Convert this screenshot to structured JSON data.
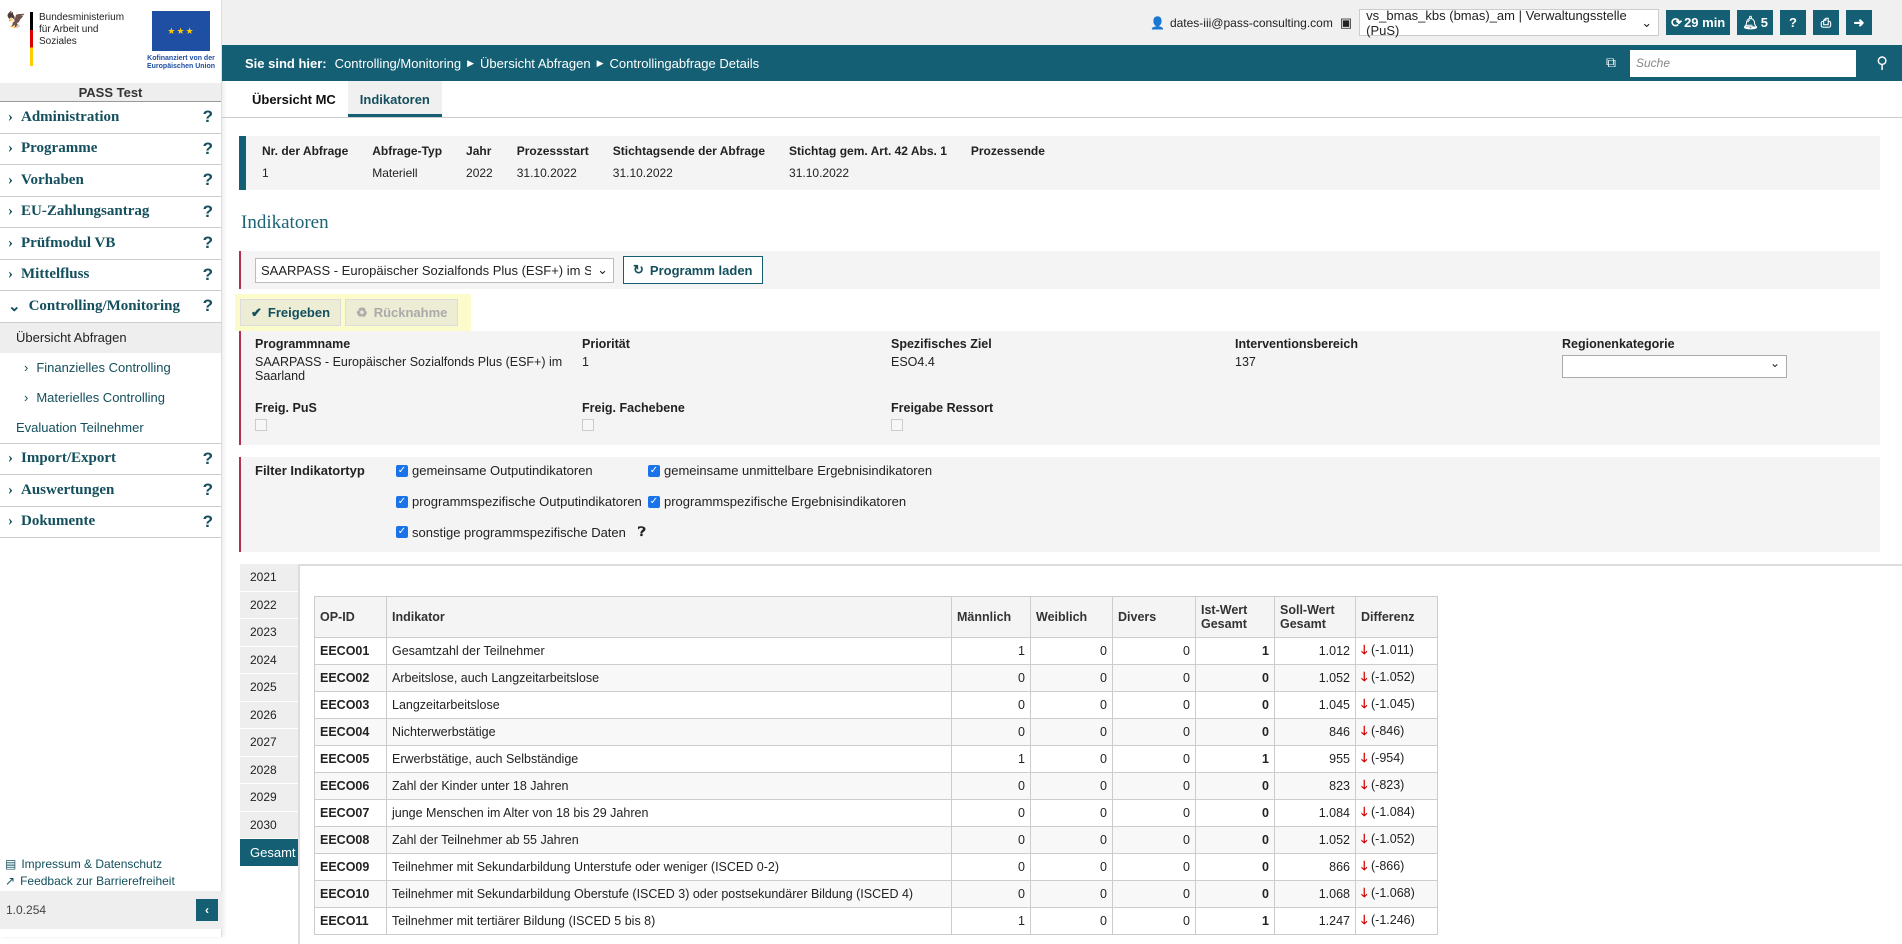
{
  "logos": {
    "ministry": "Bundesministerium für Arbeit und Soziales",
    "eu": "Kofinanziert von der Europäischen Union"
  },
  "sidebar": {
    "app_name": "PASS Test",
    "items": [
      {
        "label": "Administration"
      },
      {
        "label": "Programme"
      },
      {
        "label": "Vorhaben"
      },
      {
        "label": "EU-Zahlungsantrag"
      },
      {
        "label": "Prüfmodul VB"
      },
      {
        "label": "Mittelfluss"
      },
      {
        "label": "Controlling/Monitoring"
      }
    ],
    "subitems": [
      {
        "label": "Übersicht Abfragen"
      },
      {
        "label": "Finanzielles Controlling"
      },
      {
        "label": "Materielles Controlling"
      },
      {
        "label": "Evaluation Teilnehmer"
      }
    ],
    "items2": [
      {
        "label": "Import/Export"
      },
      {
        "label": "Auswertungen"
      },
      {
        "label": "Dokumente"
      }
    ],
    "help": "?",
    "footer": {
      "impressum": "Impressum & Datenschutz",
      "feedback": "Feedback zur Barrierefreiheit",
      "version": "1.0.254"
    }
  },
  "topbar": {
    "user": "dates-iii@pass-consulting.com",
    "role": "vs_bmas_kbs (bmas)_am | Verwaltungsstelle (PuS)",
    "session": "29 min",
    "notifications": "5",
    "help": "?"
  },
  "breadcrumb": {
    "prefix": "Sie sind hier:",
    "items": [
      "Controlling/Monitoring",
      "Übersicht Abfragen",
      "Controllingabfrage Details"
    ],
    "search_placeholder": "Suche"
  },
  "tabs": [
    {
      "label": "Übersicht MC"
    },
    {
      "label": "Indikatoren"
    }
  ],
  "info": {
    "headers": [
      "Nr. der Abfrage",
      "Abfrage-Typ",
      "Jahr",
      "Prozessstart",
      "Stichtagsende der Abfrage",
      "Stichtag gem. Art. 42 Abs. 1",
      "Prozessende"
    ],
    "values": [
      "1",
      "Materiell",
      "2022",
      "31.10.2022",
      "31.10.2022",
      "31.10.2022",
      ""
    ]
  },
  "section_title": "Indikatoren",
  "program": {
    "selected": "SAARPASS - Europäischer Sozialfonds Plus (ESF+) im Saarland",
    "load_button": "Programm laden"
  },
  "actions": {
    "release": "Freigeben",
    "withdraw": "Rücknahme"
  },
  "details": {
    "programmname_label": "Programmname",
    "programmname": "SAARPASS - Europäischer Sozialfonds Plus (ESF+) im Saarland",
    "prioritaet_label": "Priorität",
    "prioritaet": "1",
    "ziel_label": "Spezifisches Ziel",
    "ziel": "ESO4.4",
    "bereich_label": "Interventionsbereich",
    "bereich": "137",
    "region_label": "Regionenkategorie",
    "freig_pus": "Freig. PuS",
    "freig_fach": "Freig. Fachebene",
    "freig_ressort": "Freigabe Ressort"
  },
  "filter": {
    "label": "Filter Indikatortyp",
    "options": [
      "gemeinsame Outputindikatoren",
      "gemeinsame unmittelbare Ergebnisindikatoren",
      "programmspezifische Outputindikatoren",
      "programmspezifische Ergebnisindikatoren",
      "sonstige programmspezifische Daten"
    ]
  },
  "years": [
    "2021",
    "2022",
    "2023",
    "2024",
    "2025",
    "2026",
    "2027",
    "2028",
    "2029",
    "2030",
    "Gesamt"
  ],
  "active_year": "Gesamt",
  "table": {
    "headers": [
      "OP-ID",
      "Indikator",
      "Männlich",
      "Weiblich",
      "Divers",
      "Ist-Wert Gesamt",
      "Soll-Wert Gesamt",
      "Differenz"
    ],
    "rows": [
      [
        "EECO01",
        "Gesamtzahl der Teilnehmer",
        "1",
        "0",
        "0",
        "1",
        "1.012",
        "(-1.011)"
      ],
      [
        "EECO02",
        "Arbeitslose, auch Langzeitarbeitslose",
        "0",
        "0",
        "0",
        "0",
        "1.052",
        "(-1.052)"
      ],
      [
        "EECO03",
        "Langzeitarbeitslose",
        "0",
        "0",
        "0",
        "0",
        "1.045",
        "(-1.045)"
      ],
      [
        "EECO04",
        "Nichterwerbstätige",
        "0",
        "0",
        "0",
        "0",
        "846",
        "(-846)"
      ],
      [
        "EECO05",
        "Erwerbstätige, auch Selbständige",
        "1",
        "0",
        "0",
        "1",
        "955",
        "(-954)"
      ],
      [
        "EECO06",
        "Zahl der Kinder unter 18 Jahren",
        "0",
        "0",
        "0",
        "0",
        "823",
        "(-823)"
      ],
      [
        "EECO07",
        "junge Menschen im Alter von 18 bis 29 Jahren",
        "0",
        "0",
        "0",
        "0",
        "1.084",
        "(-1.084)"
      ],
      [
        "EECO08",
        "Zahl der Teilnehmer ab 55 Jahren",
        "0",
        "0",
        "0",
        "0",
        "1.052",
        "(-1.052)"
      ],
      [
        "EECO09",
        "Teilnehmer mit Sekundarbildung Unterstufe oder weniger (ISCED 0-2)",
        "0",
        "0",
        "0",
        "0",
        "866",
        "(-866)"
      ],
      [
        "EECO10",
        "Teilnehmer mit Sekundarbildung Oberstufe (ISCED 3) oder postsekundärer Bildung (ISCED 4)",
        "0",
        "0",
        "0",
        "0",
        "1.068",
        "(-1.068)"
      ],
      [
        "EECO11",
        "Teilnehmer mit tertiärer Bildung (ISCED 5 bis 8)",
        "1",
        "0",
        "0",
        "1",
        "1.247",
        "(-1.246)"
      ]
    ]
  },
  "colors": {
    "primary": "#145f73",
    "accent_border": "#b03050",
    "negative": "#d10000",
    "highlight": "#fbfbcc"
  }
}
